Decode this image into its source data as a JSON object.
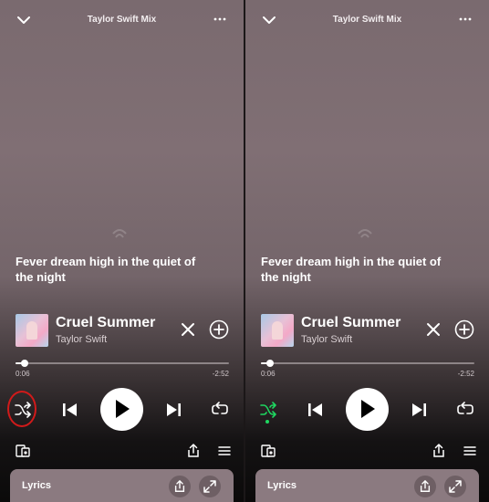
{
  "panels": [
    {
      "id": "left",
      "header": {
        "title": "Taylor Swift Mix",
        "collapse_icon": "chevron-down-icon",
        "more_icon": "more-icon"
      },
      "lyric_line": "Fever dream high in the quiet of the night",
      "now_playing": {
        "song_title": "Cruel Summer",
        "artist": "Taylor Swift"
      },
      "progress": {
        "elapsed": "0:06",
        "remaining": "-2:52",
        "fraction": 0.034
      },
      "controls": {
        "shuffle_active": false,
        "shuffle_highlighted": true
      },
      "lyrics_card": {
        "label": "Lyrics"
      }
    },
    {
      "id": "right",
      "header": {
        "title": "Taylor Swift Mix",
        "collapse_icon": "chevron-down-icon",
        "more_icon": "more-icon"
      },
      "lyric_line": "Fever dream high in the quiet of the night",
      "now_playing": {
        "song_title": "Cruel Summer",
        "artist": "Taylor Swift"
      },
      "progress": {
        "elapsed": "0:06",
        "remaining": "-2:52",
        "fraction": 0.034
      },
      "controls": {
        "shuffle_active": true,
        "shuffle_highlighted": false
      },
      "lyrics_card": {
        "label": "Lyrics"
      }
    }
  ],
  "colors": {
    "active_green": "#1ed760",
    "highlight_ring": "#d11a1a"
  }
}
